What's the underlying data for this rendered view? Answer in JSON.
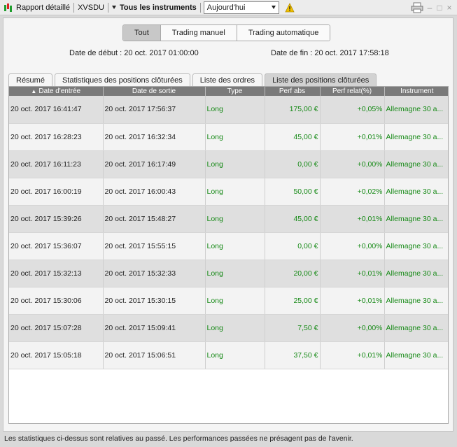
{
  "toolbar": {
    "report_label": "Rapport détaillé",
    "account": "XVSDU",
    "instruments_label": "Tous les instruments",
    "period_value": "Aujourd'hui"
  },
  "filters": {
    "buttons": [
      "Tout",
      "Trading manuel",
      "Trading automatique"
    ],
    "active_index": 0
  },
  "dates": {
    "start": "Date de début : 20 oct. 2017 01:00:00",
    "end": "Date de fin : 20 oct. 2017 17:58:18"
  },
  "tabs": {
    "items": [
      "Résumé",
      "Statistiques des positions clôturées",
      "Liste des ordres",
      "Liste des positions clôturées"
    ],
    "active_index": 3
  },
  "table": {
    "columns": [
      "Date d'entrée",
      "Date de sortie",
      "Type",
      "Perf abs",
      "Perf relat(%)",
      "Instrument"
    ],
    "rows": [
      [
        "20 oct. 2017 16:41:47",
        "20 oct. 2017 17:56:37",
        "Long",
        "175,00 €",
        "+0,05%",
        "Allemagne 30 a..."
      ],
      [
        "20 oct. 2017 16:28:23",
        "20 oct. 2017 16:32:34",
        "Long",
        "45,00 €",
        "+0,01%",
        "Allemagne 30 a..."
      ],
      [
        "20 oct. 2017 16:11:23",
        "20 oct. 2017 16:17:49",
        "Long",
        "0,00 €",
        "+0,00%",
        "Allemagne 30 a..."
      ],
      [
        "20 oct. 2017 16:00:19",
        "20 oct. 2017 16:00:43",
        "Long",
        "50,00 €",
        "+0,02%",
        "Allemagne 30 a..."
      ],
      [
        "20 oct. 2017 15:39:26",
        "20 oct. 2017 15:48:27",
        "Long",
        "45,00 €",
        "+0,01%",
        "Allemagne 30 a..."
      ],
      [
        "20 oct. 2017 15:36:07",
        "20 oct. 2017 15:55:15",
        "Long",
        "0,00 €",
        "+0,00%",
        "Allemagne 30 a..."
      ],
      [
        "20 oct. 2017 15:32:13",
        "20 oct. 2017 15:32:33",
        "Long",
        "20,00 €",
        "+0,01%",
        "Allemagne 30 a..."
      ],
      [
        "20 oct. 2017 15:30:06",
        "20 oct. 2017 15:30:15",
        "Long",
        "25,00 €",
        "+0,01%",
        "Allemagne 30 a..."
      ],
      [
        "20 oct. 2017 15:07:28",
        "20 oct. 2017 15:09:41",
        "Long",
        "7,50 €",
        "+0,00%",
        "Allemagne 30 a..."
      ],
      [
        "20 oct. 2017 15:05:18",
        "20 oct. 2017 15:06:51",
        "Long",
        "37,50 €",
        "+0,01%",
        "Allemagne 30 a..."
      ]
    ]
  },
  "footer": {
    "disclaimer": "Les statistiques ci-dessus sont relatives au passé. Les performances passées ne présagent pas de l'avenir."
  },
  "colors": {
    "positive": "#178a17",
    "header_bg": "#7a7a7a"
  }
}
